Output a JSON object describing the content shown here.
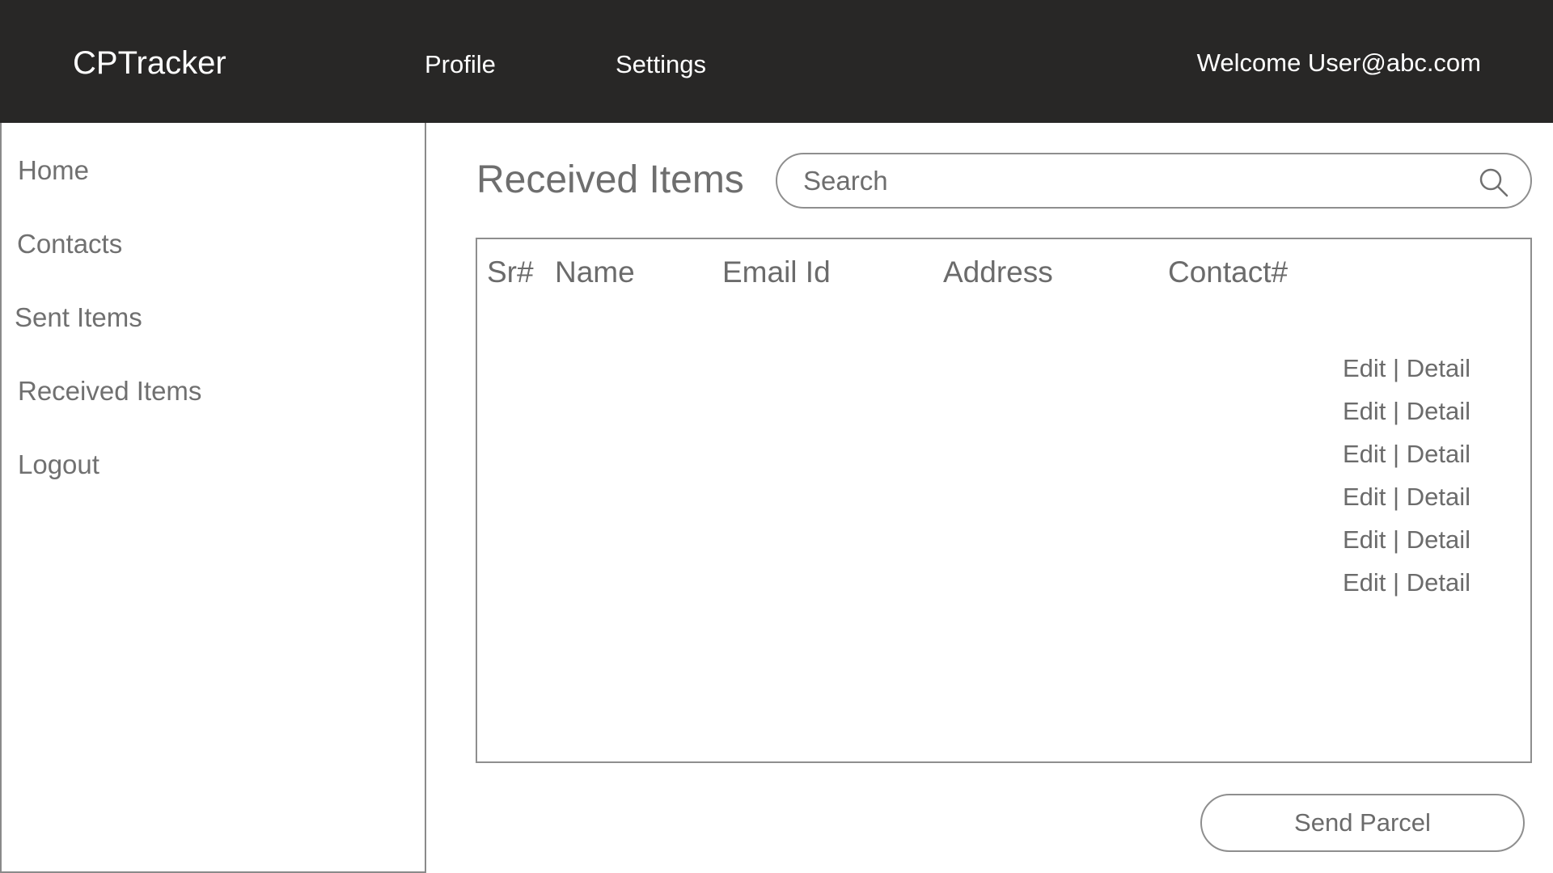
{
  "header": {
    "brand": "CPTracker",
    "nav": [
      {
        "label": "Profile"
      },
      {
        "label": "Settings"
      }
    ],
    "welcome": "Welcome User@abc.com"
  },
  "sidebar": {
    "items": [
      {
        "label": "Home"
      },
      {
        "label": "Contacts"
      },
      {
        "label": "Sent Items"
      },
      {
        "label": "Received Items"
      },
      {
        "label": "Logout"
      }
    ]
  },
  "main": {
    "title": "Received Items",
    "search": {
      "placeholder": "Search",
      "icon": "search-icon"
    },
    "table": {
      "columns": [
        "Sr#",
        "Name",
        "Email Id",
        "Address",
        "Contact#"
      ],
      "rows": [
        {
          "edit": "Edit",
          "separator": "|",
          "detail": "Detail"
        },
        {
          "edit": "Edit",
          "separator": "|",
          "detail": "Detail"
        },
        {
          "edit": "Edit",
          "separator": "|",
          "detail": "Detail"
        },
        {
          "edit": "Edit",
          "separator": "|",
          "detail": "Detail"
        },
        {
          "edit": "Edit",
          "separator": "|",
          "detail": "Detail"
        },
        {
          "edit": "Edit",
          "separator": "|",
          "detail": "Detail"
        }
      ]
    },
    "send_button": "Send Parcel"
  }
}
